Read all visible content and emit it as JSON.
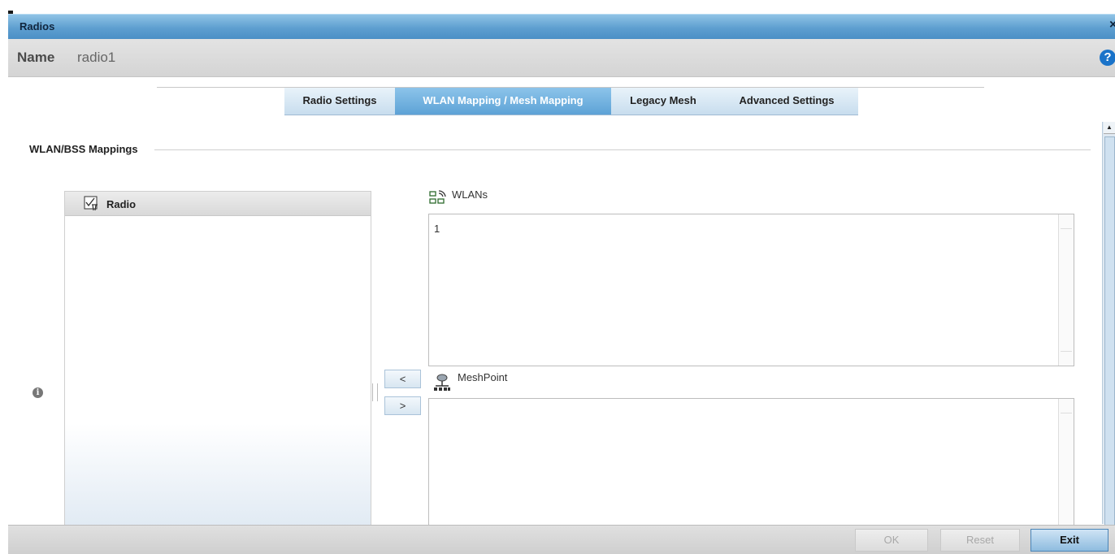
{
  "window": {
    "title": "Radios",
    "close_glyph": "×"
  },
  "name_row": {
    "label": "Name",
    "value": "radio1",
    "help_glyph": "?"
  },
  "tabs": [
    {
      "label": "Radio Settings",
      "active": false
    },
    {
      "label": "WLAN Mapping / Mesh Mapping",
      "active": true
    },
    {
      "label": "Legacy Mesh",
      "active": false
    },
    {
      "label": "Advanced Settings",
      "active": false
    }
  ],
  "section": {
    "title": "WLAN/BSS Mappings",
    "info_glyph": "i"
  },
  "radio_panel": {
    "header": "Radio",
    "icon": "radio-tree-icon"
  },
  "move_buttons": {
    "left": "<",
    "right": ">"
  },
  "wlans": {
    "label": "WLANs",
    "icon": "wlan-icon",
    "items": [
      "1"
    ]
  },
  "meshpoint": {
    "label": "MeshPoint",
    "icon": "meshpoint-icon",
    "items": []
  },
  "footer": {
    "ok": "OK",
    "reset": "Reset",
    "exit": "Exit"
  }
}
